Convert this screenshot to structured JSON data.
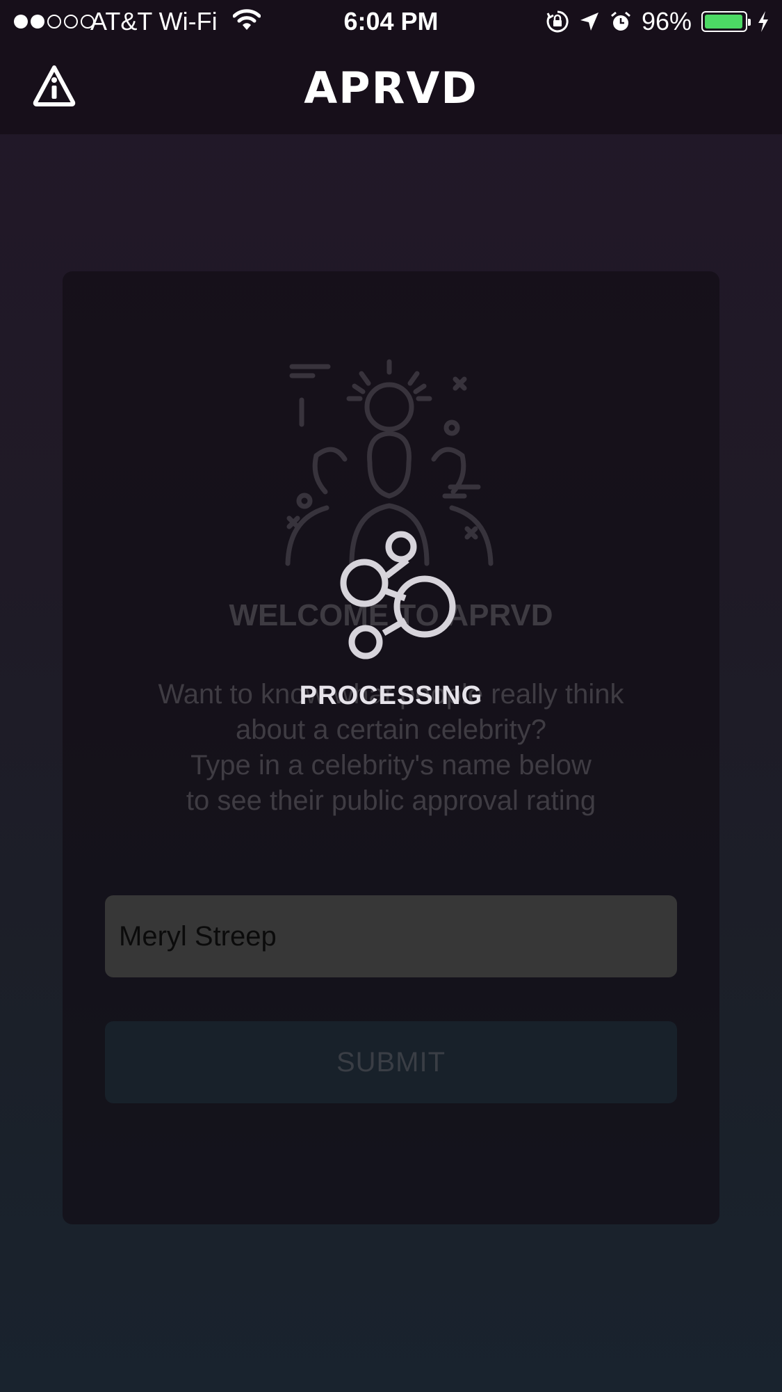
{
  "status_bar": {
    "carrier": "AT&T Wi-Fi",
    "time": "6:04 PM",
    "battery_percent": "96%",
    "battery_level": 0.96,
    "signal_bars": 2,
    "signal_total": 5,
    "icons": [
      "wifi-icon",
      "orientation-lock-icon",
      "location-arrow-icon",
      "alarm-icon",
      "battery-icon",
      "charging-bolt-icon"
    ]
  },
  "nav": {
    "title": "APRVD",
    "left_icon": "info-warning-icon"
  },
  "card": {
    "welcome_title": "WELCOME TO APRVD",
    "description": "Want to know what people really think\nabout a certain celebrity?\nType in a celebrity's name below\nto see their public approval rating",
    "input_value": "Meryl Streep",
    "submit_label": "SUBMIT"
  },
  "overlay": {
    "label": "PROCESSING",
    "icon": "share-network-icon"
  },
  "colors": {
    "battery": "#4cd964",
    "background_top": "#221728",
    "background_bottom": "#19232e"
  }
}
